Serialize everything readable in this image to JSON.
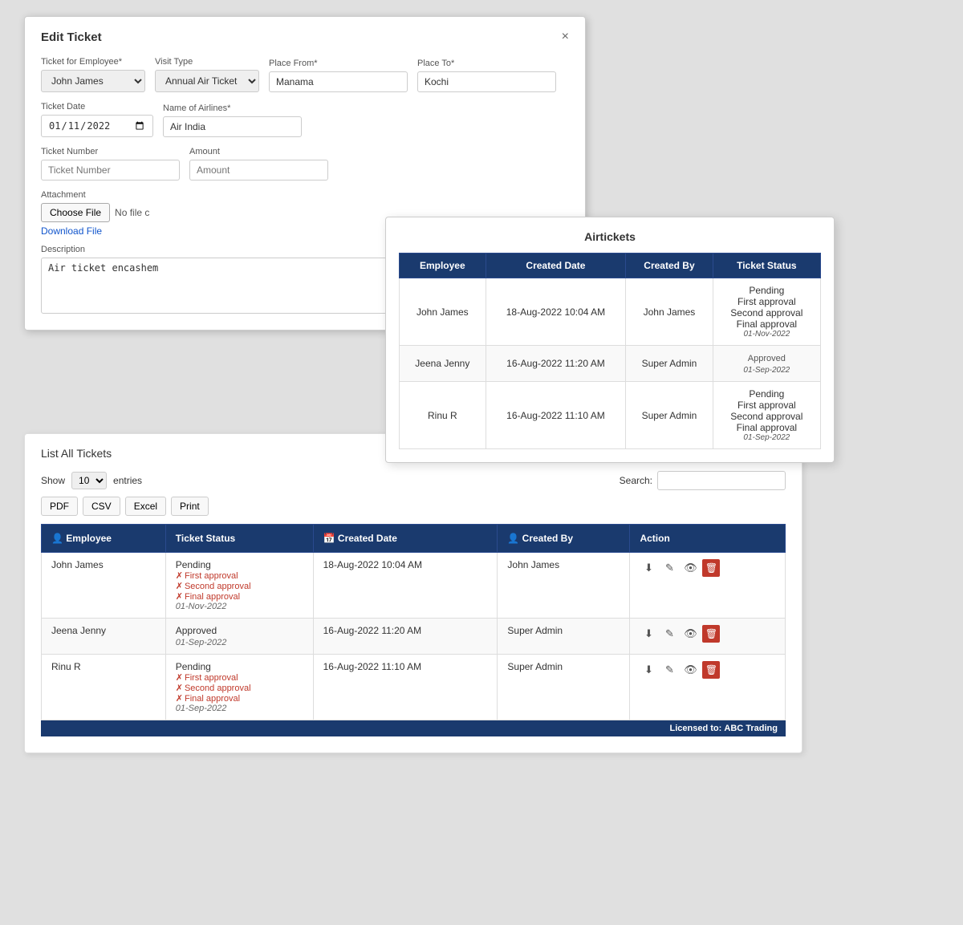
{
  "editModal": {
    "title": "Edit Ticket",
    "close": "×",
    "fields": {
      "ticketForEmployee": {
        "label": "Ticket for Employee*",
        "value": "John James"
      },
      "visitType": {
        "label": "Visit Type",
        "value": "Annual Air Ticket"
      },
      "placeFrom": {
        "label": "Place From*",
        "value": "Manama"
      },
      "placeTo": {
        "label": "Place To*",
        "value": "Kochi"
      },
      "ticketDate": {
        "label": "Ticket Date",
        "value": "01-11-2022"
      },
      "nameOfAirlines": {
        "label": "Name of Airlines*",
        "value": "Air India"
      },
      "ticketNumber": {
        "label": "Ticket Number",
        "placeholder": "Ticket Number"
      },
      "amount": {
        "label": "Amount",
        "placeholder": "Amount"
      },
      "attachment": {
        "label": "Attachment",
        "chooseFile": "Choose File",
        "noFile": "No file c",
        "download": "Download File"
      },
      "description": {
        "label": "Description",
        "value": "Air ticket encashem"
      }
    }
  },
  "airticketsPopup": {
    "title": "Airtickets",
    "columns": [
      "Employee",
      "Created Date",
      "Created By",
      "Ticket Status"
    ],
    "rows": [
      {
        "employee": "John James",
        "createdDate": "18-Aug-2022 10:04 AM",
        "createdBy": "John James",
        "statusLines": [
          "Pending",
          "First approval",
          "Second approval",
          "Final approval"
        ],
        "statusDate": "01-Nov-2022",
        "statusType": "pending"
      },
      {
        "employee": "Jeena Jenny",
        "createdDate": "16-Aug-2022 11:20 AM",
        "createdBy": "Super Admin",
        "statusLines": [
          "Approved"
        ],
        "statusDate": "01-Sep-2022",
        "statusType": "approved"
      },
      {
        "employee": "Rinu R",
        "createdDate": "16-Aug-2022 11:10 AM",
        "createdBy": "Super Admin",
        "statusLines": [
          "Pending",
          "First approval",
          "Second approval",
          "Final approval"
        ],
        "statusDate": "01-Sep-2022",
        "statusType": "pending"
      }
    ]
  },
  "listPanel": {
    "title": "List All",
    "titleBold": "Tickets",
    "show": "Show",
    "entries": "entries",
    "showCount": "10",
    "exportButtons": [
      "PDF",
      "CSV",
      "Excel",
      "Print"
    ],
    "search": "Search:",
    "searchPlaceholder": "",
    "columns": [
      "Employee",
      "Ticket Status",
      "Created Date",
      "Created By",
      "Action"
    ],
    "rows": [
      {
        "employee": "John James",
        "status": "Pending",
        "approvals": [
          "First approval",
          "Second approval",
          "Final approval"
        ],
        "statusDate": "01-Nov-2022",
        "statusType": "pending",
        "createdDate": "18-Aug-2022 10:04 AM",
        "createdBy": "John James"
      },
      {
        "employee": "Jeena Jenny",
        "status": "Approved",
        "approvals": [],
        "statusDate": "01-Sep-2022",
        "statusType": "approved",
        "createdDate": "16-Aug-2022 11:20 AM",
        "createdBy": "Super Admin"
      },
      {
        "employee": "Rinu R",
        "status": "Pending",
        "approvals": [
          "First approval",
          "Second approval",
          "Final approval"
        ],
        "statusDate": "01-Sep-2022",
        "statusType": "pending",
        "createdDate": "16-Aug-2022 11:10 AM",
        "createdBy": "Super Admin"
      }
    ],
    "licensed": "Licensed to:",
    "licensedName": "ABC Trading"
  }
}
